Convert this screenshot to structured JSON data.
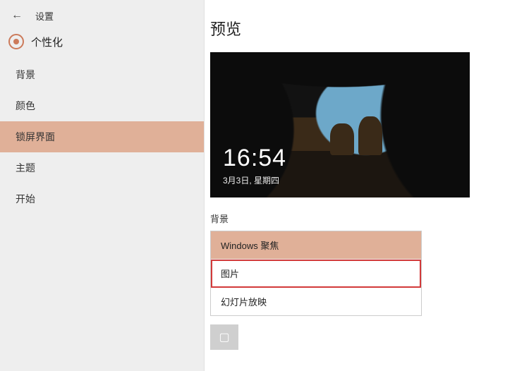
{
  "header": {
    "back_icon": "←",
    "title": "设置"
  },
  "subheader": {
    "title": "个性化"
  },
  "sidebar": {
    "items": [
      {
        "label": "背景",
        "selected": false
      },
      {
        "label": "颜色",
        "selected": false
      },
      {
        "label": "锁屏界面",
        "selected": true
      },
      {
        "label": "主题",
        "selected": false
      },
      {
        "label": "开始",
        "selected": false
      }
    ]
  },
  "main": {
    "title": "预览",
    "lock_time": "16:54",
    "lock_date": "3月3日, 星期四",
    "bg_section_label": "背景",
    "dropdown": {
      "options": [
        {
          "label": "Windows 聚焦",
          "header": true
        },
        {
          "label": "图片",
          "selected": true
        },
        {
          "label": "幻灯片放映"
        }
      ]
    }
  }
}
